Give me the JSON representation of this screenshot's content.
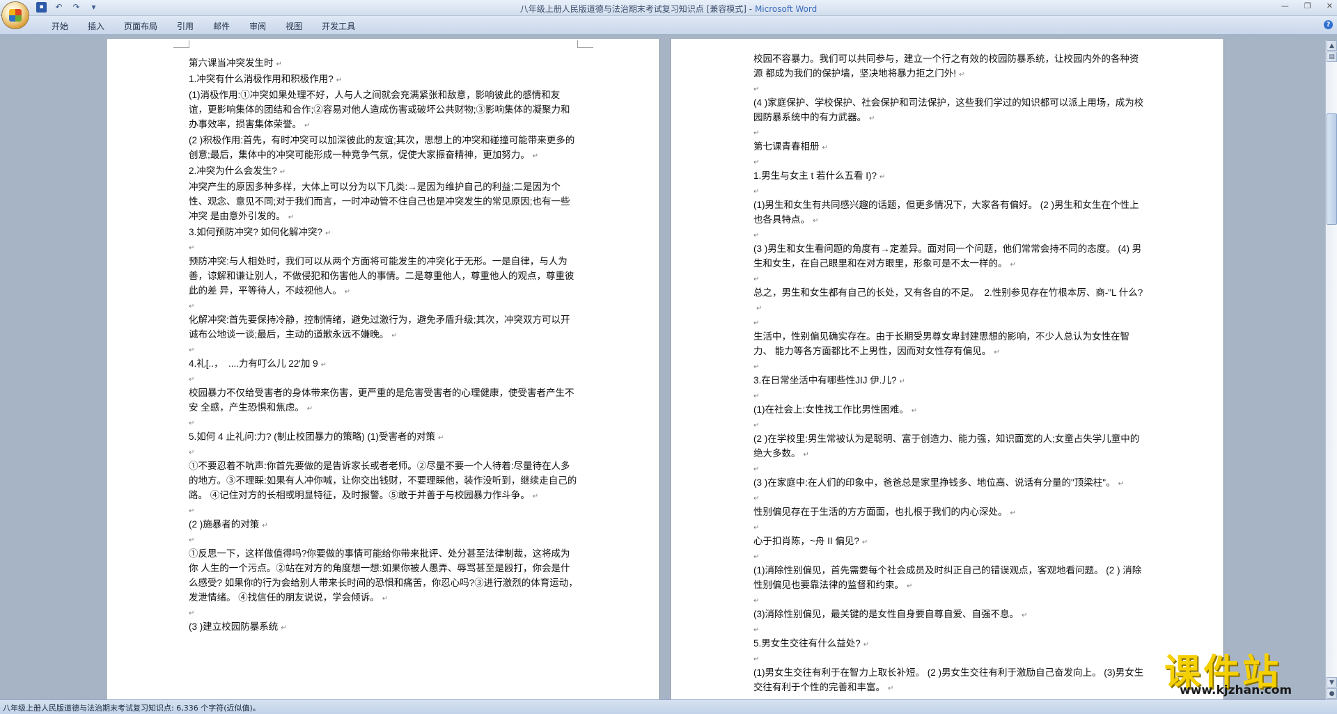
{
  "window": {
    "title_doc": "八年级上册人民版道德与法治期末考试复习知识点 [兼容模式]",
    "title_sep": " - ",
    "title_app": "Microsoft Word"
  },
  "ribbon": {
    "tabs": [
      "开始",
      "插入",
      "页面布局",
      "引用",
      "邮件",
      "审阅",
      "视图",
      "开发工具"
    ]
  },
  "left_page": [
    "第六课当冲突发生时",
    "1.冲突有什么消极作用和积极作用?",
    "(1)消极作用:①冲突如果处理不好，人与人之间就会充满紧张和敌意，影响彼此的感情和友谊，更影响集体的团结和合作;②容易对他人造成伤害或破坏公共财物;③影响集体的凝聚力和办事效率，损害集体荣誉。",
    "(2 )积极作用:首先，有时冲突可以加深彼此的友谊;其次，思想上的冲突和碰撞可能带来更多的创意;最后，集体中的冲突可能形成一种竞争气氛，促使大家振奋精神，更加努力。",
    "2.冲突为什么会发生?",
    "冲突产生的原因多种多样，大体上可以分为以下几类:→是因为维护自己的利益;二是因为个性、观念、意见不同;对于我们而言，一时冲动管不住自己也是冲突发生的常见原因;也有一些冲突 是由意外引发的。",
    "3.如何预防冲突? 如何化解冲突?",
    "",
    "预防冲突:与人相处时，我们可以从两个方面将可能发生的冲突化于无形。一是自律，与人为 善，谅解和谦让别人，不做侵犯和伤害他人的事情。二是尊重他人，尊重他人的观点，尊重彼此的差 异，平等待人，不歧视他人。",
    "",
    "化解冲突:首先要保持冷静，控制情绪，避免过激行为，避免矛盾升级;其次，冲突双方可以开 诚布公地谈一谈;最后，主动的道歉永远不嫌晚。",
    "",
    "4.礼[..，  ....力有叮么儿 22'加 9",
    "",
    "校园暴力不仅给受害者的身体带来伤害，更严重的是危害受害者的心理健康，使受害者产生不安 全感，产生恐惧和焦虑。",
    "",
    "5.如何 4 止礼问:力? (制止校团暴力的策略) (1)受害者的对策",
    "",
    "①不要忍着不吭声:你首先要做的是告诉家长或者老师。②尽量不要一个人待着:尽量待在人多 的地方。③不理睬:如果有人冲你喊，让你交出钱财，不要理睬他，装作没听到，继续走自己的路。 ④记住对方的长相或明显特征，及时报警。⑤敢于并善于与校园暴力作斗争。",
    "",
    "(2 )施暴者的对策",
    "",
    "①反思一下，这样做值得吗?你要做的事情可能给你带来批评、处分甚至法律制裁，这将成为你 人生的一个污点。②站在对方的角度想一想:如果你被人愚弄、辱骂甚至是殴打，你会是什么感受? 如果你的行为会给别人带来长时间的恐惧和痛苦，你忍心吗?③进行激烈的体育运动，发泄情绪。 ④找信任的朋友说说，学会倾诉。",
    "",
    "(3 )建立校园防暴系统"
  ],
  "right_page": [
    "校园不容暴力。我们可以共同参与，建立一个行之有效的校园防暴系统，让校园内外的各种资源 都成为我们的保护墙，坚决地将暴力拒之门外!",
    "",
    "(4 )家庭保护、学校保护、社会保护和司法保护，这些我们学过的知识都可以派上用场，成为校 园防暴系统中的有力武器。",
    "",
    "第七课青春相册",
    "",
    "1.男生与女主 t 若什么五看 I)?",
    "",
    "(1)男生和女生有共同感兴趣的话题，但更多情况下，大家各有偏好。 (2 )男生和女生在个性上也各具特点。",
    "",
    "(3 )男生和女生看问题的角度有→定差异。面对同一个问题，他们常常会持不同的态度。 (4) 男生和女生，在自己眼里和在对方眼里，形象可是不太一样的。",
    "",
    "总之，男生和女生都有自己的长处，又有各自的不足。  2.性别参见存在竹根本厉、商-\"L 什么?",
    "",
    "生活中，性别偏见确实存在。由于长期受男尊女卑封建思想的影响，不少人总认为女性在智力、 能力等各方面都比不上男性，因而对女性存有偏见。",
    "",
    "3.在日常坐活中有哪些性JIJ 伊.儿?",
    "",
    "(1)在社会上:女性找工作比男性困难。",
    "",
    "(2 )在学校里:男生常被认为是聪明、富于创造力、能力强，知识面宽的人;女童占失学儿童中的绝大多数。",
    "",
    "(3 )在家庭中:在人们的印象中，爸爸总是家里挣钱多、地位高、说话有分量的\"顶梁柱\"。",
    "",
    "性别偏见存在于生活的方方面面，也扎根于我们的内心深处。",
    "",
    "心于扣肖陈，~舟 II 偏见?",
    "",
    "(1)消除性别偏见，首先需要每个社会成员及时纠正自己的错误观点，客观地看问题。 (2 ) 消除性别偏见也要靠法律的监督和约束。",
    "",
    "(3)消除性别偏见，最关键的是女性自身要自尊自爱、自强不息。",
    "",
    "5.男女生交往有什么益处?",
    "",
    "(1)男女生交往有利于在智力上取长补短。 (2 )男女生交往有利于激励自己奋发向上。 (3)男女生交往有利于个性的完善和丰富。"
  ],
  "statusbar": {
    "text": "八年级上册人民版道德与法治期末考试复习知识点: 6,336 个字符(近似值)。"
  },
  "watermark": {
    "big": "课件站",
    "url": "www.kjzhan.com"
  },
  "colors": {
    "watermark_yellow": "#f5d000",
    "title_app": "#3a6cc0"
  }
}
